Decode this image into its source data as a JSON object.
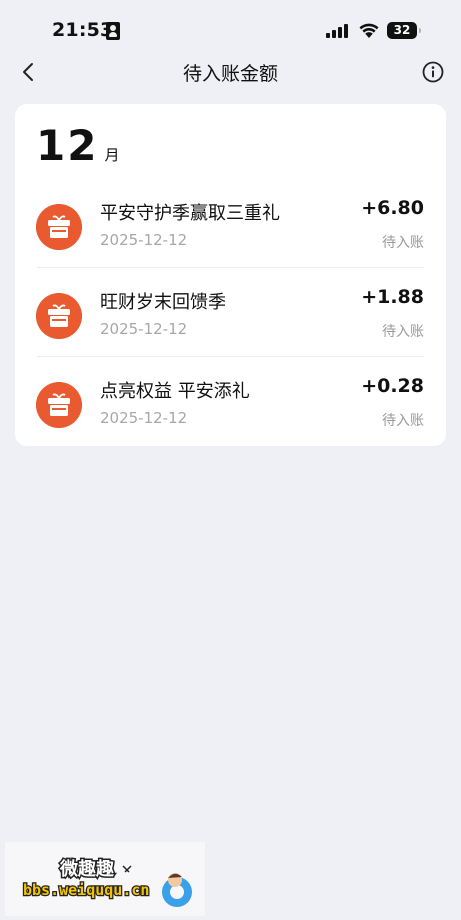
{
  "status_bar": {
    "time": "21:53",
    "battery": "32"
  },
  "header": {
    "title": "待入账金额"
  },
  "month": {
    "number": "12",
    "unit": "月"
  },
  "items": [
    {
      "title": "平安守护季赢取三重礼",
      "date": "2025-12-12",
      "amount": "+6.80",
      "status": "待入账",
      "icon": "gift-icon"
    },
    {
      "title": "旺财岁末回馈季",
      "date": "2025-12-12",
      "amount": "+1.88",
      "status": "待入账",
      "icon": "gift-icon"
    },
    {
      "title": "点亮权益 平安添礼",
      "date": "2025-12-12",
      "amount": "+0.28",
      "status": "待入账",
      "icon": "gift-icon"
    }
  ],
  "watermark": {
    "line1": "微趣趣",
    "line2": "bbs.weiququ.cn"
  },
  "colors": {
    "background": "#eff0f5",
    "card": "#ffffff",
    "gift_icon": "#ea5a30",
    "secondary_text": "#a7a7ab"
  }
}
